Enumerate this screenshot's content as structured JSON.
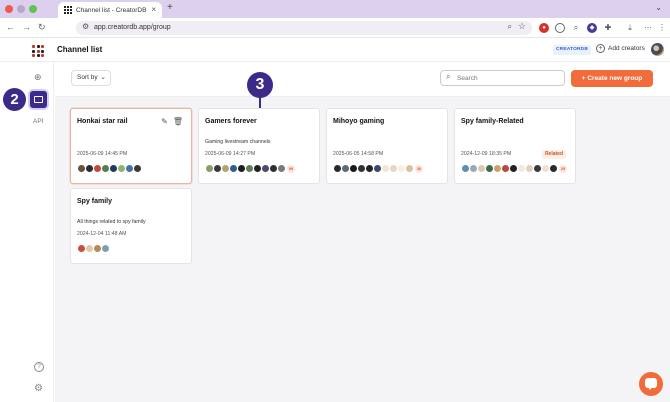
{
  "browser": {
    "tab_title": "Channel list - CreatorDB",
    "url": "app.creatordb.app/group"
  },
  "app": {
    "page_title": "Channel list",
    "brand_badge": "CREATORDB",
    "add_creators": "Add creators",
    "api_label": "API"
  },
  "toolbar": {
    "sort_label": "Sort by",
    "search_placeholder": "Search",
    "create_label": "Create new group"
  },
  "markers": {
    "step_a": "2",
    "step_b": "3"
  },
  "colors": {
    "accent": "#f26b3a",
    "marker": "#3b2a8a",
    "badge_blue": "#2f64c8"
  },
  "groups": [
    {
      "title": "Honkai star rail",
      "description": "",
      "date": "2025-06-09 14:45 PM",
      "badge": "",
      "avatars": [
        "#6b4f3a",
        "#2b2b2b",
        "#c2493d",
        "#5a7d4e",
        "#1f3b5c",
        "#8fb36e",
        "#4a6fa5",
        "#3a3a3a"
      ],
      "more": ""
    },
    {
      "title": "Gamers forever",
      "description": "Gaming livestream channels",
      "date": "2025-06-09 14:27 PM",
      "badge": "",
      "avatars": [
        "#8b9b6a",
        "#3a3a3a",
        "#b9a36b",
        "#2d5f8a",
        "#1d1d1d",
        "#5e7f55",
        "#222",
        "#4b4b6b",
        "#2f2f2f",
        "#7a7a7a"
      ],
      "more": "99"
    },
    {
      "title": "Mihoyo gaming",
      "description": "",
      "date": "2025-06-05 14:58 PM",
      "badge": "",
      "avatars": [
        "#2a2a2a",
        "#5d6a7a",
        "#1a1a1a",
        "#333",
        "#222",
        "#3a4a6a",
        "#f0e6d6",
        "#e8d6c0",
        "#f5f0e6",
        "#d9c2a0"
      ],
      "more": "30"
    },
    {
      "title": "Spy family-Related",
      "description": "",
      "date": "2024-12-09 18:35 PM",
      "badge": "Related",
      "avatars": [
        "#5b8fb5",
        "#9aa7b8",
        "#d8cbb5",
        "#3a6e4a",
        "#c9a36b",
        "#b84a3a",
        "#222",
        "#f2e8dc",
        "#e0d0c0",
        "#3a3a3a",
        "#f0e0d0",
        "#2a2a2a"
      ],
      "more": "25"
    },
    {
      "title": "Spy family",
      "description": "All things related to spy family",
      "date": "2024-12-04 11:48 AM",
      "badge": "",
      "avatars": [
        "#c94f3a",
        "#e0c8a8",
        "#b58a5a",
        "#7aa0b8"
      ],
      "more": ""
    }
  ]
}
